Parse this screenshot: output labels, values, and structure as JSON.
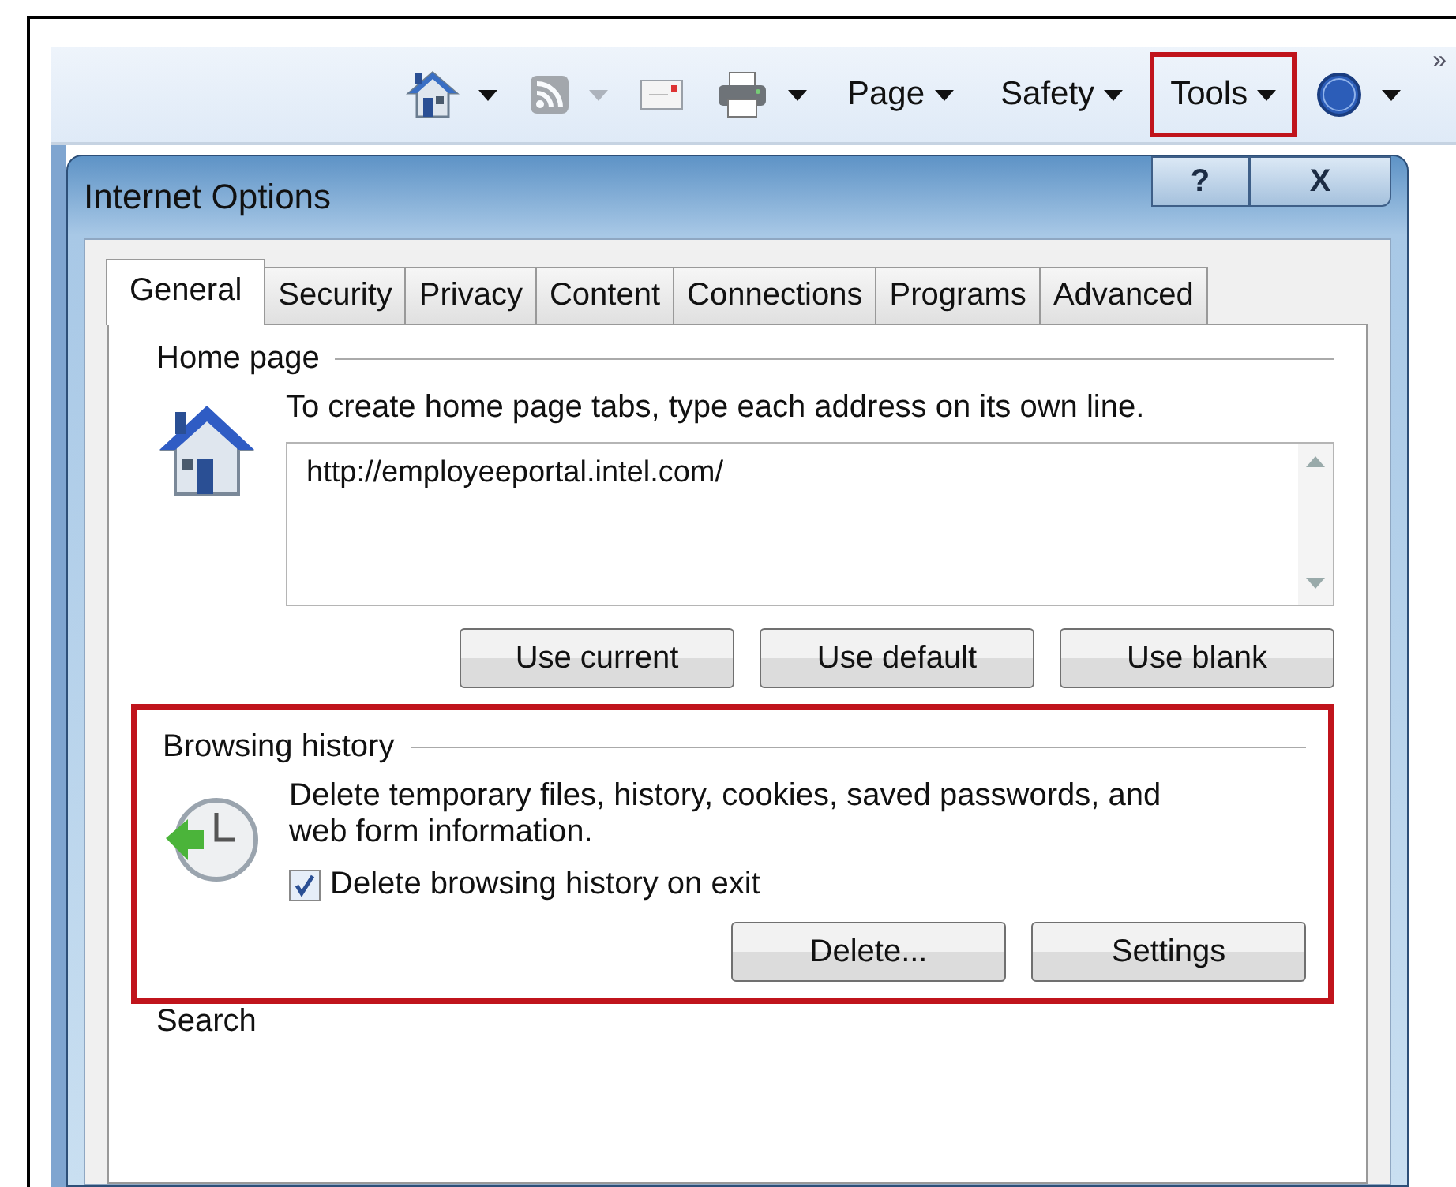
{
  "toolbar": {
    "icon_buttons": [
      {
        "kind": "home",
        "dropdown": true,
        "disabled": false
      },
      {
        "kind": "feeds",
        "dropdown": true,
        "disabled": true
      },
      {
        "kind": "mail",
        "dropdown": false,
        "disabled": false
      },
      {
        "kind": "print",
        "dropdown": true,
        "disabled": false
      }
    ],
    "menus": [
      {
        "label": "Page",
        "highlighted": false
      },
      {
        "label": "Safety",
        "highlighted": false
      },
      {
        "label": "Tools",
        "highlighted": true
      }
    ],
    "help_dropdown": true,
    "overflow": "»"
  },
  "dialog": {
    "title": "Internet Options",
    "help_button": "?",
    "close_button": "X",
    "tabs": [
      {
        "label": "General",
        "selected": true
      },
      {
        "label": "Security",
        "selected": false
      },
      {
        "label": "Privacy",
        "selected": false
      },
      {
        "label": "Content",
        "selected": false
      },
      {
        "label": "Connections",
        "selected": false
      },
      {
        "label": "Programs",
        "selected": false
      },
      {
        "label": "Advanced",
        "selected": false
      }
    ],
    "home_page": {
      "title": "Home page",
      "description": "To create home page tabs, type each address on its own line.",
      "value": "http://employeeportal.intel.com/",
      "buttons": [
        "Use current",
        "Use default",
        "Use blank"
      ]
    },
    "browsing_history": {
      "title": "Browsing history",
      "highlighted": true,
      "description": "Delete temporary files, history, cookies, saved passwords, and web form information.",
      "checkbox": {
        "label": "Delete browsing history on exit",
        "checked": true
      },
      "buttons": [
        "Delete...",
        "Settings"
      ]
    },
    "search": {
      "title": "Search"
    }
  }
}
